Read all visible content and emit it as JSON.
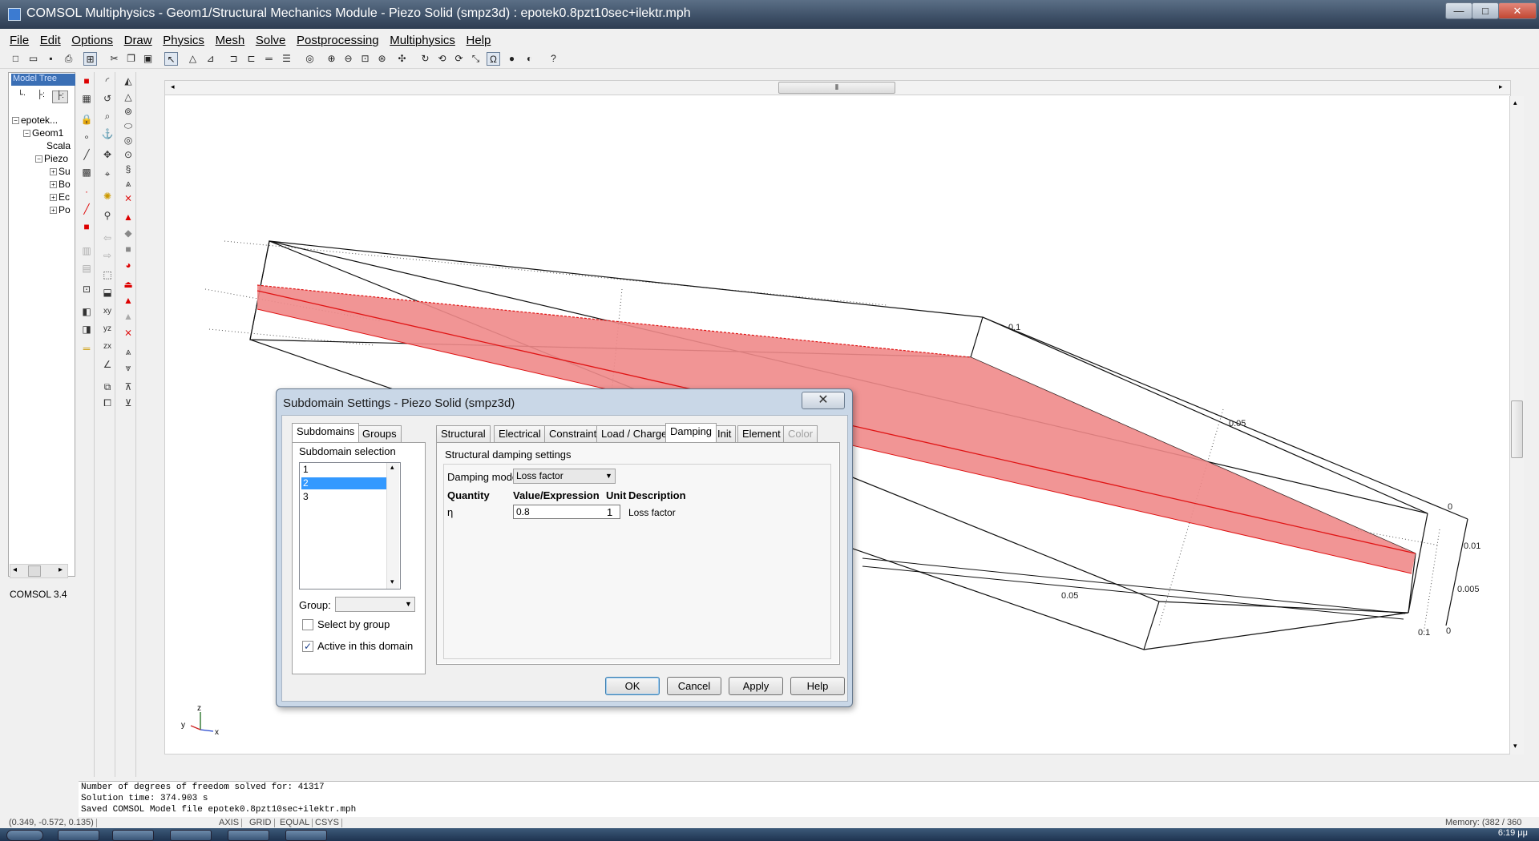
{
  "window": {
    "title": "COMSOL Multiphysics - Geom1/Structural Mechanics Module - Piezo Solid (smpz3d) : epotek0.8pzt10sec+ilektr.mph",
    "minimize": "—",
    "maximize": "□",
    "close": "✕"
  },
  "menu": [
    "File",
    "Edit",
    "Options",
    "Draw",
    "Physics",
    "Mesh",
    "Solve",
    "Postprocessing",
    "Multiphysics",
    "Help"
  ],
  "model_tree": {
    "header": "Model Tree",
    "items": [
      "epotek...",
      "Geom1",
      "Scala",
      "Piezo",
      "Su",
      "Bo",
      "Ec",
      "Po"
    ],
    "version": "COMSOL 3.4"
  },
  "canvas": {
    "axis_labels": [
      "0.1",
      "0.05",
      "0",
      "0.01",
      "0.005",
      "0",
      "0.05",
      "0.1"
    ],
    "axes": {
      "x": "x",
      "y": "y",
      "z": "z"
    },
    "shaded_color": "#f08a8a",
    "edge_color": "#e01414"
  },
  "dialog": {
    "title": "Subdomain Settings - Piezo Solid (smpz3d)",
    "close": "✕",
    "left_tabs": [
      "Subdomains",
      "Groups"
    ],
    "subdomain_selection_label": "Subdomain selection",
    "subdomains": [
      "1",
      "2",
      "3"
    ],
    "selected_subdomain": "2",
    "group_label": "Group:",
    "select_by_group": "Select by group",
    "active_in_domain": "Active in this domain",
    "right_tabs": [
      "Structural",
      "Electrical",
      "Constraint",
      "Load / Charge",
      "Damping",
      "Init",
      "Element",
      "Color"
    ],
    "active_tab": "Damping",
    "section_title": "Structural damping settings",
    "damping_model_label": "Damping model:",
    "damping_model_value": "Loss factor",
    "columns": {
      "quantity": "Quantity",
      "value": "Value/Expression",
      "unit": "Unit",
      "description": "Description"
    },
    "row": {
      "quantity": "η",
      "value": "0.8",
      "unit": "1",
      "description": "Loss factor"
    },
    "buttons": {
      "ok": "OK",
      "cancel": "Cancel",
      "apply": "Apply",
      "help": "Help"
    }
  },
  "log": [
    "Number of degrees of freedom solved for: 41317",
    "Solution time: 374.903 s",
    "Saved COMSOL Model file epotek0.8pzt10sec+ilektr.mph"
  ],
  "status": {
    "coords": "(0.349, -0.572, 0.135)",
    "axis": "AXIS",
    "grid": "GRID",
    "equal": "EQUAL",
    "csys": "CSYS",
    "memory": "Memory: (382 / 360",
    "clock": "6:19 μμ"
  }
}
